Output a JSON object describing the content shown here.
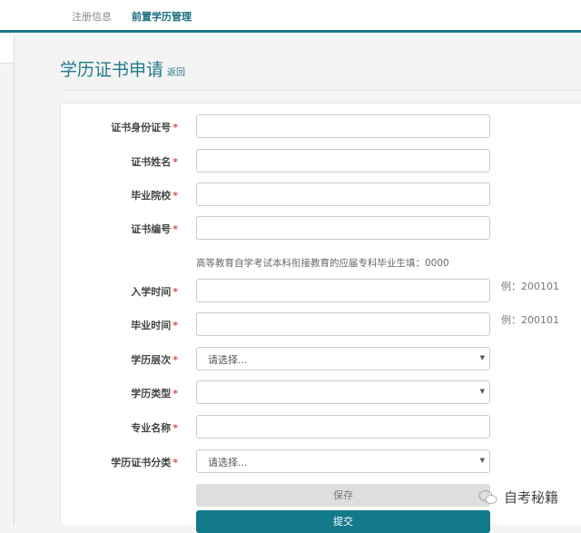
{
  "nav": {
    "tabs": [
      {
        "label": "注册信息"
      },
      {
        "label": "前置学历管理"
      }
    ]
  },
  "page": {
    "title": "学历证书申请",
    "back": "返回"
  },
  "form": {
    "required_mark": "*",
    "fields": [
      {
        "label": "证书身份证号",
        "value": ""
      },
      {
        "label": "证书姓名",
        "value": ""
      },
      {
        "label": "毕业院校",
        "value": ""
      },
      {
        "label": "证书编号",
        "value": ""
      },
      {
        "label": "入学时间",
        "value": "",
        "hint": "例：200101"
      },
      {
        "label": "毕业时间",
        "value": "",
        "hint": "例：200101"
      },
      {
        "label": "学历层次",
        "value": "请选择..."
      },
      {
        "label": "学历类型",
        "value": ""
      },
      {
        "label": "专业名称",
        "value": ""
      },
      {
        "label": "学历证书分类",
        "value": "请选择..."
      }
    ],
    "help": "高等教育自学考试本科衔接教育的应届专科毕业生填：0000",
    "save": "保存",
    "submit": "提交"
  },
  "watermark": "自考秘籍"
}
